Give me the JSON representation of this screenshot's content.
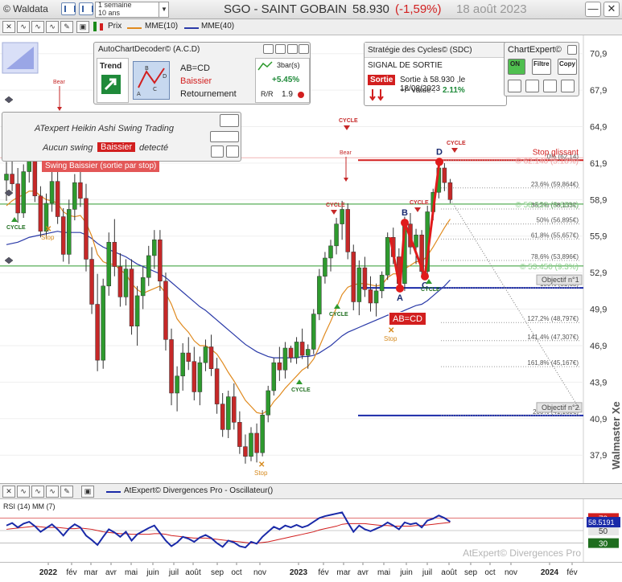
{
  "header": {
    "brand": "© Waldata",
    "period_line1": "1 semaine",
    "period_line2": "10 ans",
    "ticker": "SGO - SAINT GOBAIN",
    "price": "58.930",
    "change": "(-1,59%)",
    "date": "18 août 2023",
    "minimize_label": "—",
    "close_label": "✕"
  },
  "toolbar": {
    "price_label": "Prix",
    "ma10_label": "MME(10)",
    "ma40_label": "MME(40)",
    "colors": {
      "ma10": "#e08a1e",
      "ma40": "#2a3aa8"
    }
  },
  "chart_data": {
    "type": "candlestick",
    "title": "SGO - SAINT GOBAIN",
    "yaxis_ticks": [
      70.9,
      67.9,
      64.9,
      61.9,
      58.9,
      55.9,
      52.9,
      49.9,
      46.9,
      43.9,
      40.9,
      37.9
    ],
    "ylim": [
      35.6,
      72.4
    ],
    "xaxis_labels": [
      "2022",
      "fév",
      "mar",
      "avr",
      "mai",
      "juin",
      "juil",
      "août",
      "sep",
      "oct",
      "nov",
      "2023",
      "fév",
      "mar",
      "avr",
      "mai",
      "juin",
      "juil",
      "août",
      "sep",
      "oct",
      "nov",
      "2024",
      "fév"
    ],
    "xaxis_first_year": "2022",
    "xaxis_second_year": "2023",
    "xaxis_third_year": "2024",
    "last_price": 58.93,
    "levels": [
      {
        "name": "stop-glissant",
        "value": 62.14,
        "color": "#d21f1f"
      },
      {
        "name": "resistance-green",
        "value": 58.53,
        "color": "#2e9a2e"
      },
      {
        "name": "support-green",
        "value": 53.45,
        "color": "#2e9a2e"
      },
      {
        "name": "objectif-1",
        "value": 51.65,
        "color": "#1a2aa8"
      },
      {
        "name": "objectif-2",
        "value": 41.16,
        "color": "#1a2aa8"
      }
    ],
    "fib_levels": [
      {
        "label": "0% (62,14)",
        "value": 62.14
      },
      {
        "label": "23,6% (59,864€)",
        "value": 59.86
      },
      {
        "label": "38,2% (58,133€)",
        "value": 58.13
      },
      {
        "label": "50% (56,895€)",
        "value": 56.9
      },
      {
        "label": "61,8% (55,657€)",
        "value": 55.66
      },
      {
        "label": "78,6% (53,896€)",
        "value": 53.9
      },
      {
        "label": "100% (51,65)",
        "value": 51.65
      },
      {
        "label": "127,2% (48,797€)",
        "value": 48.8
      },
      {
        "label": "141,4% (47,307€)",
        "value": 47.31
      },
      {
        "label": "161,8% (45,167€)",
        "value": 45.17
      },
      {
        "label": "200% (41,160€)",
        "value": 41.16
      }
    ],
    "pattern_points": [
      {
        "label": "A",
        "value": 51.6
      },
      {
        "label": "B",
        "value": 57.0
      },
      {
        "label": "C",
        "value": 52.6
      },
      {
        "label": "D",
        "value": 62.0
      }
    ],
    "annotations": {
      "stop_glissant": "Stop glissant",
      "stop_value_label": "© 62.140 (5.18%)",
      "level_5853_label": "© 58.530 (0.68%)",
      "level_5345_label": "© 53.450 (9.3%)",
      "objectif1": "Objectif n°1",
      "objectif2": "Objectif n°2",
      "abcd_badge": "AB=CD",
      "cycle": "CYCLE",
      "stop": "Stop",
      "bear": "Bear",
      "walmaster": "Walmaster Xe"
    },
    "candles": [
      [
        60.5,
        62.0,
        58.8,
        61.0
      ],
      [
        61.0,
        62.4,
        59.6,
        60.2
      ],
      [
        60.2,
        61.5,
        57.0,
        57.8
      ],
      [
        57.8,
        61.8,
        57.4,
        61.2
      ],
      [
        61.2,
        63.0,
        60.3,
        62.1
      ],
      [
        62.1,
        62.8,
        58.7,
        59.2
      ],
      [
        59.2,
        60.0,
        55.8,
        56.3
      ],
      [
        56.3,
        59.4,
        55.7,
        58.6
      ],
      [
        58.6,
        61.2,
        57.9,
        60.4
      ],
      [
        60.4,
        61.5,
        56.9,
        57.5
      ],
      [
        57.5,
        58.2,
        53.8,
        54.4
      ],
      [
        54.4,
        58.9,
        53.6,
        58.1
      ],
      [
        58.1,
        61.0,
        57.2,
        60.3
      ],
      [
        60.3,
        62.0,
        58.3,
        59.0
      ],
      [
        59.0,
        60.2,
        53.0,
        54.0
      ],
      [
        54.0,
        55.0,
        49.5,
        50.3
      ],
      [
        50.3,
        52.8,
        44.8,
        45.7
      ],
      [
        45.7,
        52.4,
        45.0,
        51.8
      ],
      [
        51.8,
        56.2,
        51.0,
        55.4
      ],
      [
        55.4,
        57.3,
        52.6,
        53.4
      ],
      [
        53.4,
        54.5,
        50.1,
        50.9
      ],
      [
        50.9,
        54.0,
        50.2,
        53.2
      ],
      [
        53.2,
        54.0,
        47.8,
        48.5
      ],
      [
        48.5,
        51.8,
        46.9,
        51.0
      ],
      [
        51.0,
        53.4,
        49.9,
        52.5
      ],
      [
        52.5,
        55.1,
        51.8,
        54.3
      ],
      [
        54.3,
        56.4,
        53.2,
        55.6
      ],
      [
        55.6,
        56.4,
        51.4,
        52.2
      ],
      [
        52.2,
        52.9,
        46.5,
        47.4
      ],
      [
        47.4,
        48.3,
        42.0,
        43.0
      ],
      [
        43.0,
        45.2,
        41.5,
        44.4
      ],
      [
        44.4,
        47.1,
        43.2,
        46.3
      ],
      [
        46.3,
        47.6,
        44.9,
        45.6
      ],
      [
        45.6,
        46.8,
        42.4,
        43.1
      ],
      [
        43.1,
        46.0,
        42.0,
        45.5
      ],
      [
        45.5,
        47.4,
        44.8,
        46.8
      ],
      [
        46.8,
        47.8,
        44.4,
        45.0
      ],
      [
        45.0,
        45.9,
        41.3,
        42.1
      ],
      [
        42.1,
        43.0,
        39.4,
        40.0
      ],
      [
        40.0,
        43.2,
        39.3,
        42.7
      ],
      [
        42.7,
        43.8,
        40.0,
        40.6
      ],
      [
        40.6,
        41.5,
        38.0,
        38.6
      ],
      [
        38.6,
        39.6,
        37.2,
        37.8
      ],
      [
        37.8,
        40.2,
        37.4,
        39.7
      ],
      [
        39.7,
        40.5,
        37.3,
        38.1
      ],
      [
        38.1,
        41.6,
        37.8,
        41.2
      ],
      [
        41.2,
        43.6,
        40.6,
        43.2
      ],
      [
        43.2,
        45.9,
        42.8,
        45.5
      ],
      [
        45.5,
        46.8,
        44.0,
        44.9
      ],
      [
        44.9,
        47.2,
        44.2,
        46.7
      ],
      [
        46.7,
        46.9,
        45.5,
        45.9
      ],
      [
        45.9,
        47.6,
        45.4,
        47.2
      ],
      [
        47.2,
        48.3,
        45.8,
        46.1
      ],
      [
        46.1,
        47.0,
        45.0,
        46.6
      ],
      [
        46.6,
        49.9,
        46.2,
        49.5
      ],
      [
        49.5,
        53.2,
        49.0,
        52.6
      ],
      [
        52.6,
        54.6,
        52.0,
        54.1
      ],
      [
        54.1,
        55.6,
        53.0,
        55.1
      ],
      [
        55.1,
        57.4,
        54.4,
        56.9
      ],
      [
        56.9,
        58.8,
        55.6,
        58.1
      ],
      [
        58.1,
        58.6,
        54.0,
        54.6
      ],
      [
        54.6,
        55.2,
        49.8,
        50.5
      ],
      [
        50.5,
        53.9,
        49.4,
        53.3
      ],
      [
        53.3,
        54.2,
        50.9,
        51.5
      ],
      [
        51.5,
        52.6,
        49.7,
        50.4
      ],
      [
        50.4,
        52.0,
        49.3,
        51.4
      ],
      [
        51.4,
        53.0,
        50.8,
        52.7
      ],
      [
        52.7,
        56.2,
        52.3,
        55.8
      ],
      [
        55.8,
        56.6,
        53.6,
        54.2
      ],
      [
        54.2,
        54.9,
        51.5,
        52.0
      ],
      [
        52.0,
        57.5,
        51.4,
        56.9
      ],
      [
        56.9,
        57.8,
        54.4,
        55.0
      ],
      [
        55.0,
        56.5,
        53.6,
        56.0
      ],
      [
        56.0,
        56.4,
        52.5,
        53.0
      ],
      [
        53.0,
        58.4,
        52.7,
        57.9
      ],
      [
        57.9,
        59.8,
        57.2,
        59.5
      ],
      [
        59.5,
        62.2,
        59.0,
        61.5
      ],
      [
        61.5,
        61.9,
        59.6,
        60.3
      ],
      [
        60.3,
        60.6,
        58.6,
        58.9
      ]
    ],
    "ma10": [
      58.4,
      58.8,
      59.1,
      59.3,
      59.6,
      59.6,
      59.2,
      58.9,
      58.8,
      58.6,
      57.9,
      57.6,
      57.5,
      57.6,
      57.0,
      55.9,
      54.4,
      53.8,
      53.6,
      53.6,
      53.1,
      52.8,
      52.0,
      51.5,
      51.2,
      51.4,
      51.6,
      51.8,
      51.2,
      50.3,
      49.1,
      48.5,
      48.0,
      47.3,
      46.9,
      46.9,
      46.6,
      46.2,
      45.5,
      44.7,
      44.0,
      43.2,
      42.4,
      41.9,
      41.4,
      41.3,
      41.6,
      42.3,
      42.8,
      43.4,
      43.9,
      44.4,
      44.9,
      45.2,
      45.8,
      46.8,
      47.9,
      48.9,
      50.0,
      51.1,
      51.7,
      51.9,
      52.0,
      52.0,
      51.9,
      51.8,
      51.9,
      52.5,
      52.8,
      52.8,
      53.2,
      53.5,
      53.8,
      53.8,
      54.3,
      55.0,
      55.8,
      56.6,
      57.3
    ],
    "ma40": [
      55.2,
      55.3,
      55.4,
      55.6,
      55.8,
      55.9,
      56.0,
      56.1,
      56.2,
      56.3,
      56.2,
      56.2,
      56.2,
      56.2,
      56.0,
      55.7,
      55.3,
      55.0,
      54.8,
      54.6,
      54.4,
      54.2,
      53.9,
      53.6,
      53.4,
      53.2,
      53.0,
      52.8,
      52.5,
      52.1,
      51.7,
      51.3,
      50.9,
      50.5,
      50.1,
      49.8,
      49.4,
      49.0,
      48.6,
      48.2,
      47.8,
      47.4,
      47.0,
      46.7,
      46.4,
      46.2,
      46.0,
      45.9,
      45.9,
      45.9,
      45.9,
      45.9,
      46.0,
      46.0,
      46.1,
      46.3,
      46.6,
      46.9,
      47.3,
      47.7,
      48.0,
      48.2,
      48.4,
      48.6,
      48.8,
      49.0,
      49.2,
      49.4,
      49.5,
      49.6,
      49.8,
      50.0,
      50.2,
      50.3,
      50.6,
      51.0,
      51.4,
      51.8,
      52.3
    ],
    "rsi": [
      58,
      62,
      55,
      61,
      64,
      57,
      48,
      54,
      60,
      52,
      42,
      53,
      60,
      55,
      42,
      35,
      27,
      40,
      52,
      47,
      40,
      48,
      34,
      44,
      49,
      54,
      58,
      46,
      34,
      25,
      31,
      40,
      37,
      32,
      39,
      43,
      38,
      30,
      24,
      34,
      31,
      25,
      23,
      32,
      29,
      40,
      48,
      56,
      52,
      58,
      55,
      59,
      55,
      58,
      64,
      70,
      73,
      75,
      77,
      79,
      63,
      48,
      58,
      52,
      49,
      53,
      57,
      63,
      58,
      52,
      63,
      60,
      62,
      55,
      66,
      69,
      74,
      70,
      64
    ],
    "rsi_ma": [
      52,
      53,
      54,
      55,
      56,
      57,
      56,
      55,
      55,
      55,
      54,
      53,
      53,
      54,
      53,
      52,
      50,
      48,
      47,
      46,
      45,
      45,
      44,
      44,
      44,
      44,
      45,
      45,
      44,
      42,
      41,
      40,
      39,
      38,
      38,
      38,
      37,
      36,
      35,
      34,
      33,
      32,
      31,
      30,
      30,
      31,
      32,
      34,
      36,
      38,
      40,
      42,
      44,
      46,
      48,
      51,
      53,
      55,
      57,
      60,
      61,
      61,
      61,
      61,
      60,
      59,
      58,
      58,
      57,
      57,
      57,
      57,
      58,
      58,
      59,
      60,
      61,
      62,
      63
    ],
    "rsi_levels": {
      "upper": 70,
      "mid": 50,
      "lower": 30
    },
    "rsi_last": "58.5191"
  },
  "panels": {
    "acd": {
      "title": "AutoChartDecoder© (A.C.D)",
      "trend_label": "Trend",
      "pattern": "AB=CD",
      "direction": "Baissier",
      "type": "Retournement",
      "bars_label": "3bar(s)",
      "perf": "+5.45%",
      "rr_value": "1.9"
    },
    "sdc": {
      "title": "Stratégie des Cycles© (SDC)",
      "signal": "SIGNAL DE SORTIE",
      "exit_badge": "Sortie",
      "exit_text": "Sortie à 58.930 ,le  18/08/2023",
      "value_label": "+/- value :",
      "value": "2.11%"
    },
    "chartexpert": {
      "title": "ChartExpert©",
      "on_label": "ON",
      "filter_label": "Filtre",
      "copy_label": "Copy"
    },
    "heikin": {
      "title": "ATexpert Heikin Ashi Swing Trading",
      "status_pre": "Aucun swing",
      "status_badge": "Baissier",
      "status_post": "detecté",
      "swing_banner": "Swing Baissier (sortie par stop)"
    }
  },
  "oscillator": {
    "title": "AtExpert© Divergences Pro - Oscillateur()",
    "rsi_label": "RSI (14) MM (7)",
    "watermark": "AtExpert© Divergences Pro",
    "level_70": "70",
    "level_50": "50",
    "level_30": "30"
  }
}
